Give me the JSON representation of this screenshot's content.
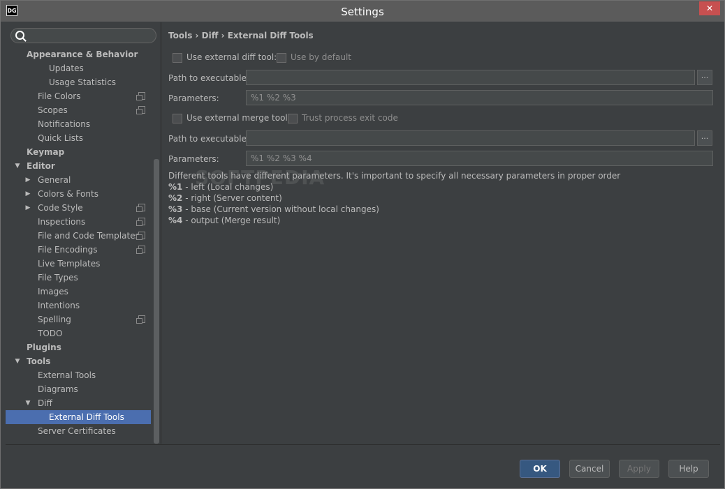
{
  "window": {
    "title": "Settings",
    "app_icon": "DG",
    "close_glyph": "✕"
  },
  "sidebar": {
    "items": [
      {
        "label": "Appearance & Behavior",
        "level": 0,
        "bold": true
      },
      {
        "label": "Updates",
        "level": 2
      },
      {
        "label": "Usage Statistics",
        "level": 2
      },
      {
        "label": "File Colors",
        "level": 1,
        "project_icon": true
      },
      {
        "label": "Scopes",
        "level": 1,
        "project_icon": true
      },
      {
        "label": "Notifications",
        "level": 1
      },
      {
        "label": "Quick Lists",
        "level": 1
      },
      {
        "label": "Keymap",
        "level": 0,
        "bold": true
      },
      {
        "label": "Editor",
        "level": 0,
        "bold": true,
        "arrow": "down"
      },
      {
        "label": "General",
        "level": 1,
        "arrow": "right"
      },
      {
        "label": "Colors & Fonts",
        "level": 1,
        "arrow": "right"
      },
      {
        "label": "Code Style",
        "level": 1,
        "arrow": "right",
        "project_icon": true
      },
      {
        "label": "Inspections",
        "level": 1,
        "project_icon": true
      },
      {
        "label": "File and Code Templates",
        "level": 1,
        "project_icon": true
      },
      {
        "label": "File Encodings",
        "level": 1,
        "project_icon": true
      },
      {
        "label": "Live Templates",
        "level": 1
      },
      {
        "label": "File Types",
        "level": 1
      },
      {
        "label": "Images",
        "level": 1
      },
      {
        "label": "Intentions",
        "level": 1
      },
      {
        "label": "Spelling",
        "level": 1,
        "project_icon": true
      },
      {
        "label": "TODO",
        "level": 1
      },
      {
        "label": "Plugins",
        "level": 0,
        "bold": true
      },
      {
        "label": "Tools",
        "level": 0,
        "bold": true,
        "arrow": "down"
      },
      {
        "label": "External Tools",
        "level": 1
      },
      {
        "label": "Diagrams",
        "level": 1
      },
      {
        "label": "Diff",
        "level": 1,
        "arrow": "down"
      },
      {
        "label": "External Diff Tools",
        "level": 2,
        "selected": true
      },
      {
        "label": "Server Certificates",
        "level": 1
      }
    ]
  },
  "breadcrumb": "Tools › Diff › External Diff Tools",
  "diff": {
    "use_external_label": "Use external diff tool:",
    "use_by_default_label": "Use by default",
    "path_label": "Path to executable:",
    "path_value": "",
    "params_label": "Parameters:",
    "params_value": "%1 %2 %3"
  },
  "merge": {
    "use_external_label": "Use external merge tool:",
    "trust_exit_label": "Trust process exit code",
    "path_label": "Path to executable:",
    "path_value": "",
    "params_label": "Parameters:",
    "params_value": "%1 %2 %3 %4"
  },
  "browse_label": "...",
  "description": {
    "intro": "Different tools have different parameters. It's important to specify all necessary parameters in proper order",
    "p1_key": "%1",
    "p1_text": " - left (Local changes)",
    "p2_key": "%2",
    "p2_text": " - right (Server content)",
    "p3_key": "%3",
    "p3_text": " - base (Current version without local changes)",
    "p4_key": "%4",
    "p4_text": " - output (Merge result)"
  },
  "watermark": "SOFTPEDIA",
  "footer": {
    "ok": "OK",
    "cancel": "Cancel",
    "apply": "Apply",
    "help": "Help"
  }
}
